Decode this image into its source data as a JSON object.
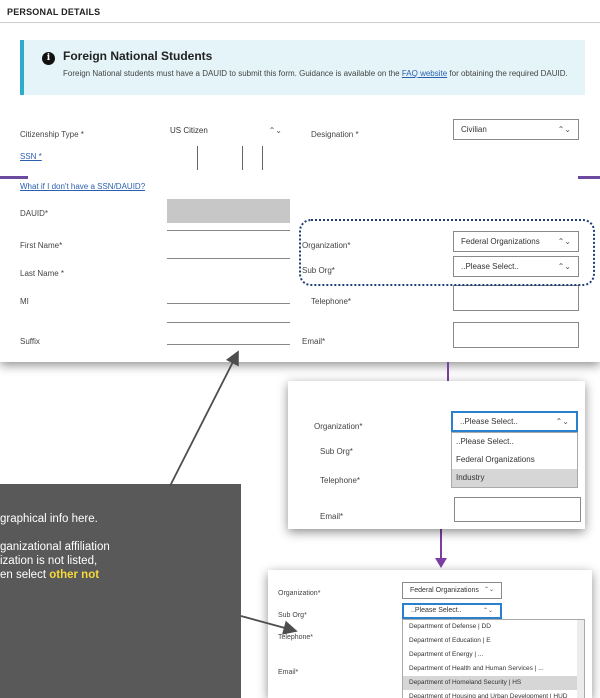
{
  "section_title": "PERSONAL DETAILS",
  "notice": {
    "title": "Foreign National Students",
    "text_before": "Foreign National students must have a DAUID to submit this form. Guidance is available on the ",
    "link": "FAQ website",
    "text_after": " for obtaining the required DAUID."
  },
  "form": {
    "citizenship_label": "Citizenship Type *",
    "citizenship_value": "US Citizen",
    "designation_label": "Designation *",
    "designation_value": "Civilian",
    "ssn_label": "SSN *",
    "ssn_help_link": "What if I don't have a SSN/DAUID?",
    "dauid_label": "DAUID*",
    "first_name_label": "First Name*",
    "last_name_label": "Last Name *",
    "mi_label": "MI",
    "suffix_label": "Suffix",
    "organization_label": "Organization*",
    "organization_value": "Federal Organizations",
    "sub_org_label": "Sub Org*",
    "sub_org_value": "..Please Select..",
    "telephone_label": "Telephone*",
    "email_label": "Email*"
  },
  "dropdown1": {
    "organization_label": "Organization*",
    "organization_value": "..Please Select..",
    "sub_org_label": "Sub Org*",
    "telephone_label": "Telephone*",
    "email_label": "Email*",
    "options": [
      "..Please Select..",
      "Federal Organizations",
      "Industry"
    ],
    "selected_index": 2
  },
  "dropdown2": {
    "organization_label": "Organization*",
    "organization_value": "Federal Organizations",
    "sub_org_label": "Sub Org*",
    "sub_org_value": "..Please Select..",
    "telephone_label": "Telephone*",
    "email_label": "Email*",
    "options": [
      "Department of Defense | DD",
      "Department of Education | E",
      "Department of Energy | ...",
      "Department of Health and Human Services | ...",
      "Department of Homeland Security | HS",
      "Department of Housing and Urban Development | HUD"
    ],
    "selected_index": 4
  },
  "callout": {
    "line1": "graphical info here.",
    "line2": "ganizational affiliation",
    "line3": "ization is not listed,",
    "line4_prefix": "en select ",
    "line4_highlight": "other not"
  },
  "colors": {
    "accent_teal": "#2eaccb",
    "link_blue": "#2a5fb0",
    "connector_purple": "#7b3fa3",
    "focus_blue": "#2b7fcf",
    "highlight_yellow": "#f5d83c",
    "callout_gray": "#595959"
  }
}
